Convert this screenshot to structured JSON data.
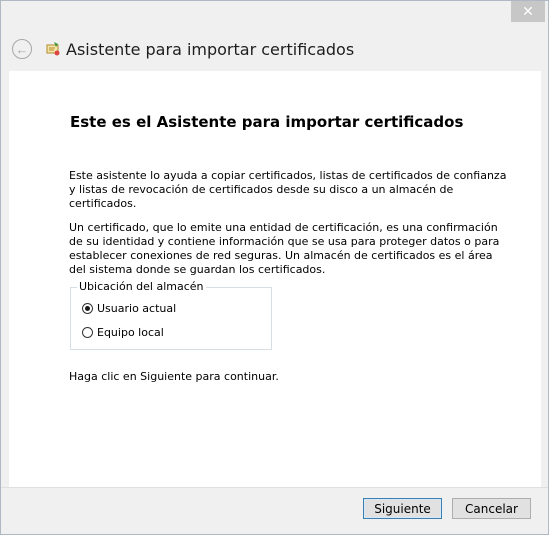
{
  "window": {
    "title": "Asistente para importar certificados",
    "close_glyph": "✕"
  },
  "header": {
    "back_icon": "back-arrow-icon",
    "wizard_icon": "certificate-wizard-icon"
  },
  "main": {
    "heading": "Este es el Asistente para importar certificados",
    "paragraph1": "Este asistente lo ayuda a copiar certificados, listas de certificados de confianza y listas de revocación de certificados desde su disco a un almacén de certificados.",
    "paragraph2": "Un certificado, que lo emite una entidad de certificación, es una confirmación de su identidad y contiene información que se usa para proteger datos o para establecer conexiones de red seguras. Un almacén de certificados es el área del sistema donde se guardan los certificados.",
    "store_group": {
      "legend": "Ubicación del almacén",
      "options": [
        {
          "label": "Usuario actual",
          "checked": true
        },
        {
          "label": "Equipo local",
          "checked": false
        }
      ]
    },
    "continue_text": "Haga clic en Siguiente para continuar."
  },
  "footer": {
    "next_label": "Siguiente",
    "cancel_label": "Cancelar"
  },
  "colors": {
    "accent_border": "#3c7fb1",
    "window_bg": "#f0f0f0",
    "content_bg": "#ffffff"
  }
}
